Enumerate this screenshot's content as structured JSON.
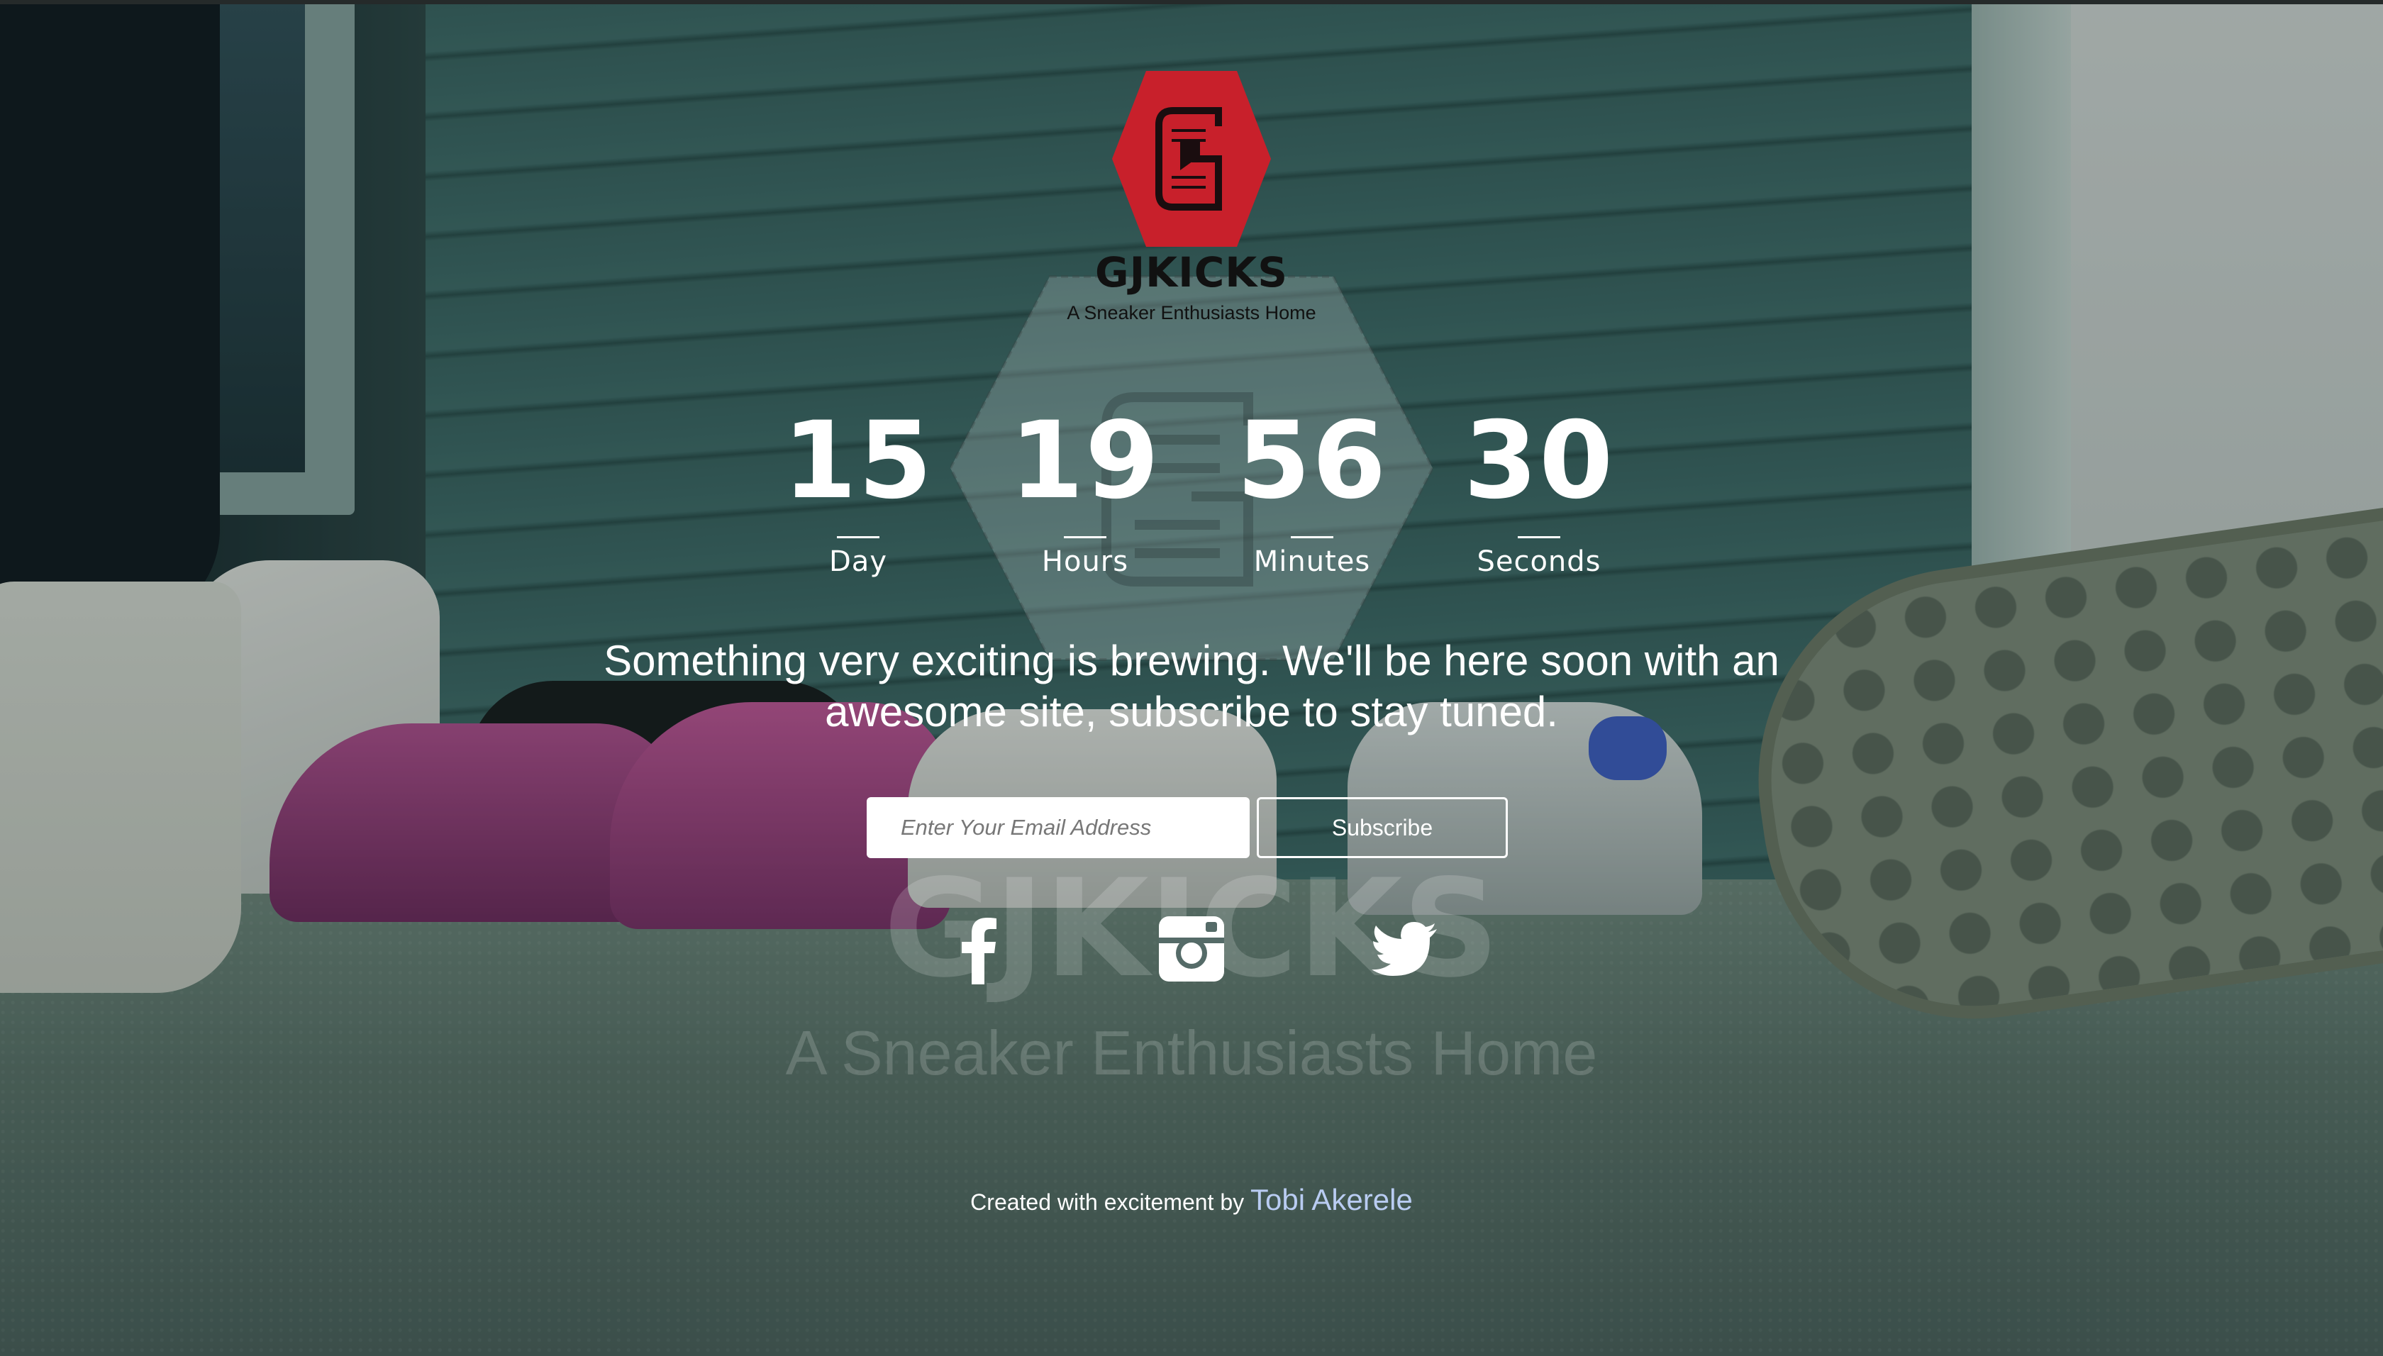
{
  "brand": {
    "name": "GJKICKS",
    "tagline": "A Sneaker Enthusiasts Home",
    "logo_color": "#c8202b"
  },
  "countdown": [
    {
      "value": "15",
      "label": "Day"
    },
    {
      "value": "19",
      "label": "Hours"
    },
    {
      "value": "56",
      "label": "Minutes"
    },
    {
      "value": "30",
      "label": "Seconds"
    }
  ],
  "message": "Something very exciting is brewing. We'll be here soon with an awesome site, subscribe to stay tuned.",
  "form": {
    "email_placeholder": "Enter Your Email Address",
    "subscribe_label": "Subscribe"
  },
  "watermark": {
    "name": "GJKICKS",
    "tagline": "A Sneaker Enthusiasts Home"
  },
  "social": [
    {
      "name": "facebook-icon"
    },
    {
      "name": "instagram-icon"
    },
    {
      "name": "twitter-icon"
    }
  ],
  "footer": {
    "prefix": "Created with excitement by",
    "author": "Tobi Akerele",
    "author_color": "#b9ccf2"
  }
}
